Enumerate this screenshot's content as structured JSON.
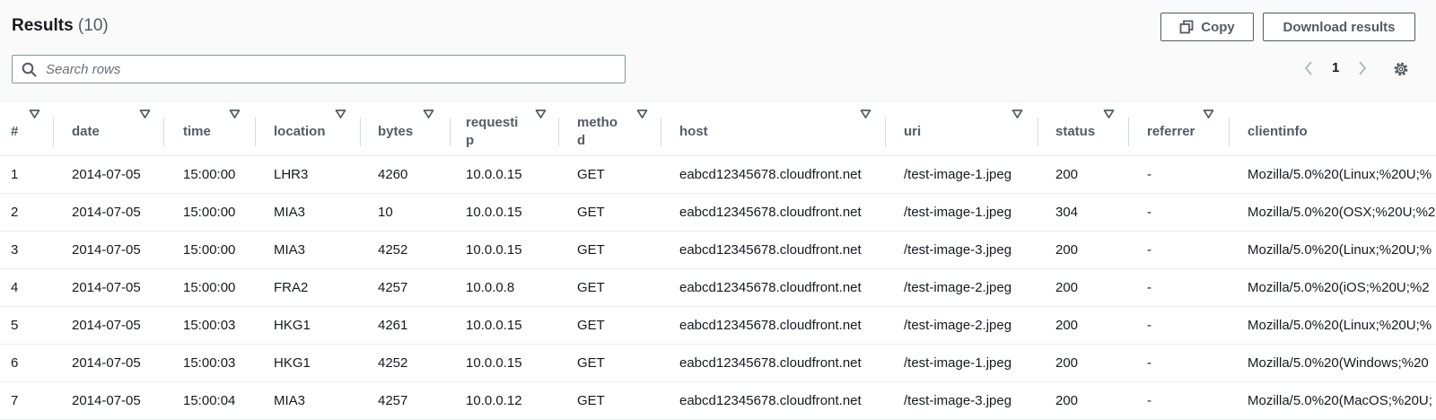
{
  "header": {
    "title": "Results",
    "count": "(10)",
    "copy_label": "Copy",
    "download_label": "Download results"
  },
  "search": {
    "placeholder": "Search rows",
    "value": ""
  },
  "pagination": {
    "current_page": "1"
  },
  "table": {
    "columns": [
      {
        "label": "#"
      },
      {
        "label": "date"
      },
      {
        "label": "time"
      },
      {
        "label": "location"
      },
      {
        "label": "bytes"
      },
      {
        "label": "requesti\np"
      },
      {
        "label": "metho\nd"
      },
      {
        "label": "host"
      },
      {
        "label": "uri"
      },
      {
        "label": "status"
      },
      {
        "label": "referrer"
      },
      {
        "label": "clientinfo"
      }
    ],
    "rows": [
      [
        "1",
        "2014-07-05",
        "15:00:00",
        "LHR3",
        "4260",
        "10.0.0.15",
        "GET",
        "eabcd12345678.cloudfront.net",
        "/test-image-1.jpeg",
        "200",
        "-",
        "Mozilla/5.0%20(Linux;%20U;%"
      ],
      [
        "2",
        "2014-07-05",
        "15:00:00",
        "MIA3",
        "10",
        "10.0.0.15",
        "GET",
        "eabcd12345678.cloudfront.net",
        "/test-image-1.jpeg",
        "304",
        "-",
        "Mozilla/5.0%20(OSX;%20U;%2"
      ],
      [
        "3",
        "2014-07-05",
        "15:00:00",
        "MIA3",
        "4252",
        "10.0.0.15",
        "GET",
        "eabcd12345678.cloudfront.net",
        "/test-image-3.jpeg",
        "200",
        "-",
        "Mozilla/5.0%20(Linux;%20U;%"
      ],
      [
        "4",
        "2014-07-05",
        "15:00:00",
        "FRA2",
        "4257",
        "10.0.0.8",
        "GET",
        "eabcd12345678.cloudfront.net",
        "/test-image-2.jpeg",
        "200",
        "-",
        "Mozilla/5.0%20(iOS;%20U;%2"
      ],
      [
        "5",
        "2014-07-05",
        "15:00:03",
        "HKG1",
        "4261",
        "10.0.0.15",
        "GET",
        "eabcd12345678.cloudfront.net",
        "/test-image-2.jpeg",
        "200",
        "-",
        "Mozilla/5.0%20(Linux;%20U;%"
      ],
      [
        "6",
        "2014-07-05",
        "15:00:03",
        "HKG1",
        "4252",
        "10.0.0.15",
        "GET",
        "eabcd12345678.cloudfront.net",
        "/test-image-1.jpeg",
        "200",
        "-",
        "Mozilla/5.0%20(Windows;%20"
      ],
      [
        "7",
        "2014-07-05",
        "15:00:04",
        "MIA3",
        "4257",
        "10.0.0.12",
        "GET",
        "eabcd12345678.cloudfront.net",
        "/test-image-3.jpeg",
        "200",
        "-",
        "Mozilla/5.0%20(MacOS;%20U;"
      ]
    ]
  }
}
